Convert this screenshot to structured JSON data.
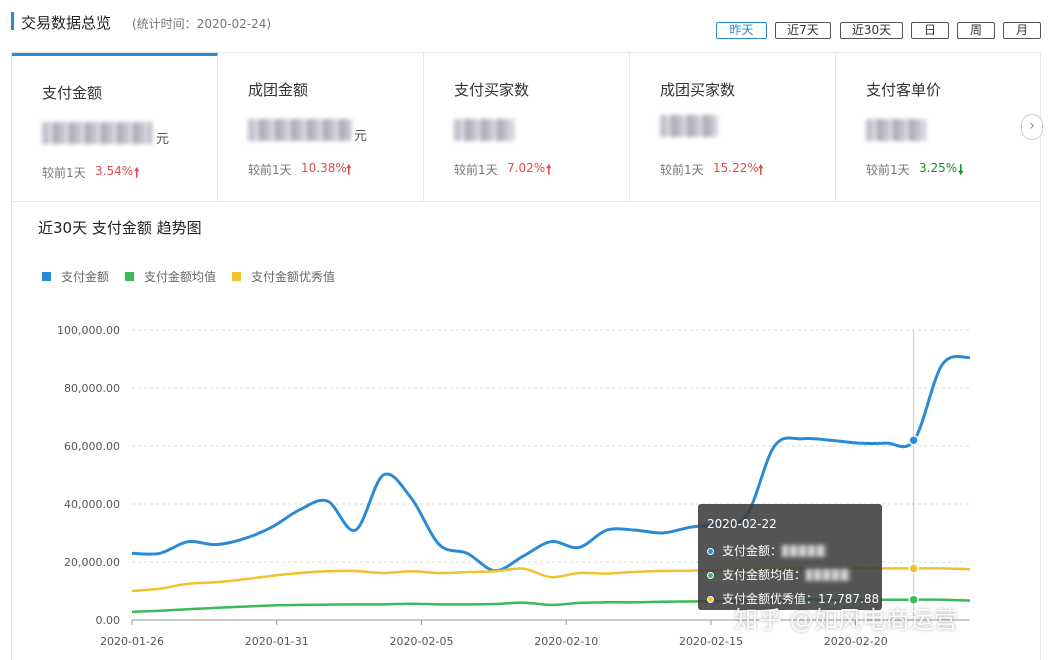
{
  "header": {
    "title": "交易数据总览",
    "subtitle": "(统计时间：2020-02-24)",
    "ranges": [
      "昨天",
      "近7天",
      "近30天",
      "日",
      "周",
      "月"
    ],
    "active_range": "昨天"
  },
  "kpis": [
    {
      "name": "支付金额",
      "unit": "元",
      "compare_label": "较前1天",
      "change": "3.54%",
      "direction": "up"
    },
    {
      "name": "成团金额",
      "unit": "元",
      "compare_label": "较前1天",
      "change": "10.38%",
      "direction": "up"
    },
    {
      "name": "支付买家数",
      "unit": "",
      "compare_label": "较前1天",
      "change": "7.02%",
      "direction": "up"
    },
    {
      "name": "成团买家数",
      "unit": "",
      "compare_label": "较前1天",
      "change": "15.22%",
      "direction": "up"
    },
    {
      "name": "支付客单价",
      "unit": "",
      "compare_label": "较前1天",
      "change": "3.25%",
      "direction": "down"
    }
  ],
  "colors": {
    "series_1": "#2b8ad6",
    "series_2": "#3cb95a",
    "series_3": "#f2c12e",
    "up": "#e04a4a",
    "down": "#1c8a2c"
  },
  "tooltip": {
    "date": "2020-02-22",
    "rows": [
      {
        "label": "支付金额：",
        "value": ""
      },
      {
        "label": "支付金额均值：",
        "value": ""
      },
      {
        "label": "支付金额优秀值：",
        "value": "17,787.88"
      }
    ]
  },
  "watermark": "知乎 @如风电商运营",
  "chart_data": {
    "type": "line",
    "title": "近30天 支付金额 趋势图",
    "x": [
      "2020-01-26",
      "2020-01-27",
      "2020-01-28",
      "2020-01-29",
      "2020-01-30",
      "2020-01-31",
      "2020-02-01",
      "2020-02-02",
      "2020-02-03",
      "2020-02-04",
      "2020-02-05",
      "2020-02-06",
      "2020-02-07",
      "2020-02-08",
      "2020-02-09",
      "2020-02-10",
      "2020-02-11",
      "2020-02-12",
      "2020-02-13",
      "2020-02-14",
      "2020-02-15",
      "2020-02-16",
      "2020-02-17",
      "2020-02-18",
      "2020-02-19",
      "2020-02-20",
      "2020-02-21",
      "2020-02-22",
      "2020-02-23"
    ],
    "xticks": [
      "2020-01-26",
      "2020-01-31",
      "2020-02-05",
      "2020-02-10",
      "2020-02-15",
      "2020-02-20"
    ],
    "yticks": [
      "0.00",
      "20,000.00",
      "40,000.00",
      "60,000.00",
      "80,000.00",
      "100,000.00"
    ],
    "ylim": [
      0,
      100000
    ],
    "grid": true,
    "legend": "top-left",
    "highlight_x": "2020-02-22",
    "series": [
      {
        "name": "支付金额",
        "values": [
          23000,
          23000,
          27000,
          26000,
          28000,
          32000,
          38000,
          41000,
          31000,
          50000,
          42000,
          26000,
          23000,
          17000,
          22000,
          27000,
          25000,
          31000,
          31000,
          30000,
          32000,
          33000,
          36000,
          60000,
          62500,
          62000,
          61000,
          61000,
          62000,
          88000,
          90500
        ]
      },
      {
        "name": "支付金额均值",
        "values": [
          2800,
          3200,
          3700,
          4200,
          4600,
          5000,
          5200,
          5300,
          5400,
          5400,
          5600,
          5400,
          5400,
          5500,
          6000,
          5200,
          5900,
          6100,
          6100,
          6300,
          6400,
          6500,
          6600,
          6800,
          7000,
          7000,
          7000,
          7000,
          7000,
          7000,
          6700
        ]
      },
      {
        "name": "支付金额优秀值",
        "values": [
          10000,
          10800,
          12500,
          13000,
          14000,
          15200,
          16200,
          16800,
          16900,
          16200,
          16800,
          16200,
          16500,
          16800,
          17700,
          14800,
          16200,
          16000,
          16600,
          16900,
          17000,
          17300,
          17300,
          17600,
          17800,
          17800,
          17800,
          17800,
          17800,
          17800,
          17500
        ]
      }
    ]
  }
}
